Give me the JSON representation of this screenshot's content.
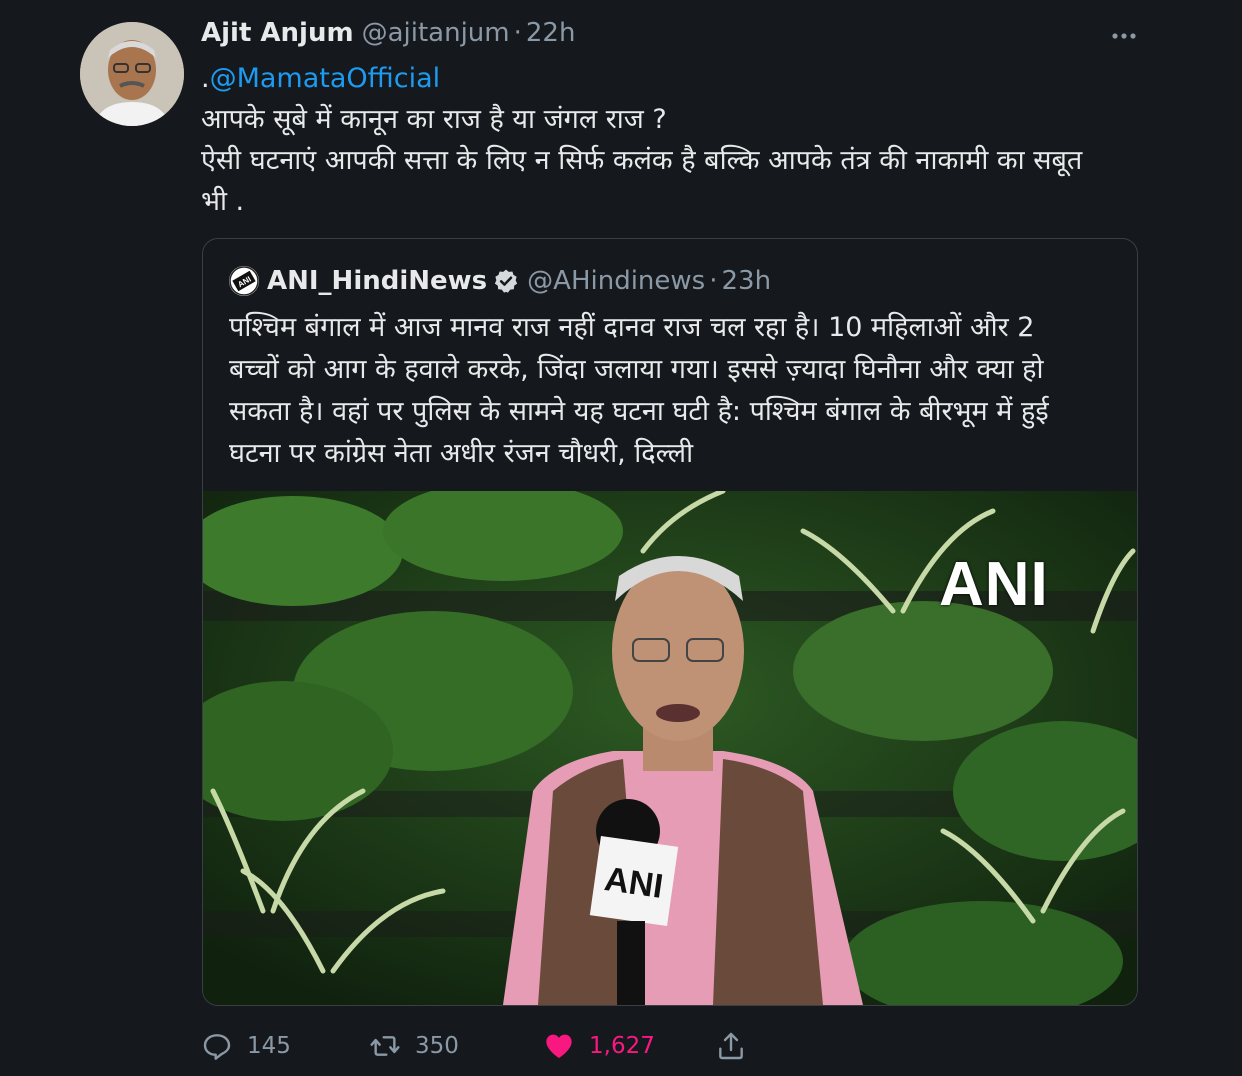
{
  "tweet": {
    "author_name": "Ajit Anjum",
    "author_handle": "@ajitanjum",
    "separator": "·",
    "time": "22h",
    "mention_prefix": ".",
    "mention": "@MamataOfficial",
    "lines": [
      "आपके सूबे में कानून का राज है या जंगल राज ?",
      "ऐसी घटनाएं आपकी सत्ता के लिए न सिर्फ कलंक है बल्कि आपके तंत्र की नाकामी का सबूत",
      "भी ."
    ]
  },
  "quoted": {
    "author_name": "ANI_HindiNews",
    "author_handle": "@AHindinews",
    "separator": "·",
    "time": "23h",
    "lines": [
      "पश्चिम बंगाल में आज मानव राज नहीं दानव राज चल रहा है। 10 महिलाओं और 2",
      "बच्चों को आग के हवाले करके, जिंदा जलाया गया। इससे ज़्यादा घिनौना और क्या हो",
      "सकता है। वहां पर पुलिस के सामने यह घटना घटी है: पश्चिम बंगाल के बीरभूम में हुई",
      "घटना पर कांग्रेस नेता अधीर रंजन चौधरी, दिल्ली"
    ],
    "media_watermark": "ANI",
    "mic_label": "ANI"
  },
  "actions": {
    "reply_count": "145",
    "retweet_count": "350",
    "like_count": "1,627"
  },
  "icons": [
    "more-icon",
    "verified-icon",
    "reply-icon",
    "retweet-icon",
    "like-icon",
    "share-icon"
  ],
  "colors": {
    "background": "#15181c",
    "link": "#1d9bf0",
    "secondary": "#8b98a5",
    "like": "#f91880"
  }
}
